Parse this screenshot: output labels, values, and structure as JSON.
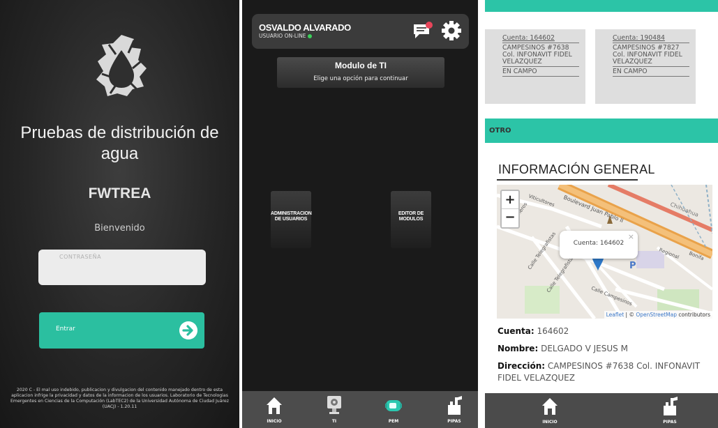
{
  "login": {
    "title": "Pruebas de distribución de agua",
    "brand": "FWTREA",
    "welcome": "Bienvenido",
    "password_placeholder": "CONTRASEÑA",
    "enter_label": "Entrar",
    "footer": "2020 C - El mal uso indebido, publicacion y divulgacion del contenido manejado dentro de esta aplicacion infrige la privacidad y datos de la informacion de los usuarios. Laboratorio de Tecnologias Emergentes en Ciencias de la Computación (LabTEC2) de la Universidad Autónoma de Ciudad Juárez (UACJ) - 1.20.11",
    "accent": "#2bbfa0"
  },
  "menu": {
    "user_name": "OSVALDO ALVARADO",
    "user_status": "USUARIO ON-LINE",
    "module_title": "Modulo de TI",
    "module_subtitle": "Elige una opción para continuar",
    "tiles": [
      {
        "label": "ADMINISTRACION DE USUARIOS"
      },
      {
        "label": "EDITOR DE MODULOS"
      }
    ],
    "nav": [
      {
        "label": "INICIO",
        "icon": "home-icon"
      },
      {
        "label": "TI",
        "icon": "computer-icon"
      },
      {
        "label": "PEM",
        "icon": "meter-icon"
      },
      {
        "label": "PIPAS",
        "icon": "water-tank-icon"
      }
    ]
  },
  "detail": {
    "cards": [
      {
        "cuenta": "Cuenta: 164602",
        "address": "CAMPESINOS #7638 Col. INFONAVIT FIDEL VELAZQUEZ",
        "status": "EN CAMPO"
      },
      {
        "cuenta": "Cuenta: 190484",
        "address": "CAMPESINOS #7827 Col. INFONAVIT FIDEL VELAZQUEZ",
        "status": "EN CAMPO"
      }
    ],
    "section_label": "OTRO",
    "info_title": "INFORMACIÓN GENERAL",
    "map": {
      "zoom_in": "+",
      "zoom_out": "−",
      "popup": "Cuenta: 164602",
      "popup_close": "×",
      "streets": [
        "Boulevard Juan Pablo II",
        "Chihuahua",
        "Calle Telegrafistas",
        "Calle Campesinos",
        "Calle Telegrafistas",
        "Mineros",
        "Viticultores",
        "Regional",
        "Bonifa"
      ],
      "parking": "P",
      "attr_leaflet": "Leaflet",
      "attr_sep": " | © ",
      "attr_osm": "OpenStreetMap",
      "attr_rest": " contributors"
    },
    "fields": [
      {
        "label": "Cuenta:",
        "value": "164602"
      },
      {
        "label": "Nombre:",
        "value": "DELGADO V JESUS M"
      },
      {
        "label": "Dirección:",
        "value": "CAMPESINOS #7638 Col. INFONAVIT FIDEL VELAZQUEZ"
      }
    ],
    "nav": [
      {
        "label": "INICIO",
        "icon": "home-icon"
      },
      {
        "label": "PIPAS",
        "icon": "water-tank-icon"
      }
    ]
  }
}
